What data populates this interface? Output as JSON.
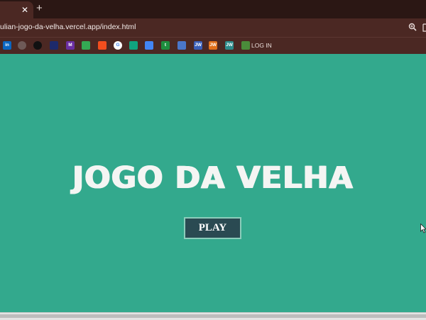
{
  "browser": {
    "tab_close": "✕",
    "new_tab": "+",
    "url": "ulian-jogo-da-velha.vercel.app/index.html",
    "bookmarks": [
      {
        "icon": "linkedin-icon",
        "color": "#0a66c2",
        "text": "in"
      },
      {
        "icon": "github-icon",
        "color": "#6e5a57",
        "text": ""
      },
      {
        "icon": "vercel-icon",
        "color": "#111111",
        "text": ""
      },
      {
        "icon": "brand-icon",
        "color": "#1d2a6b",
        "text": ""
      },
      {
        "icon": "m-icon",
        "color": "#6b2fa3",
        "text": "M"
      },
      {
        "icon": "play-store-icon",
        "color": "#34a853",
        "text": ""
      },
      {
        "icon": "figma-icon",
        "color": "#f24e1e",
        "text": ""
      },
      {
        "icon": "google-icon",
        "color": "#ffffff",
        "text": "G"
      },
      {
        "icon": "chatgpt-icon",
        "color": "#10a37f",
        "text": ""
      },
      {
        "icon": "docs-icon",
        "color": "#4285f4",
        "text": ""
      },
      {
        "icon": "sheets-t-icon",
        "color": "#1e8e3e",
        "text": "t"
      },
      {
        "icon": "square-icon",
        "color": "#4a76c9",
        "text": ""
      },
      {
        "icon": "jw-blue-icon",
        "color": "#3a5fb8",
        "text": "JW"
      },
      {
        "icon": "jw-orange-icon",
        "color": "#e0701b",
        "text": "JW"
      },
      {
        "icon": "jw-teal-icon",
        "color": "#2d8b8b",
        "text": "JW"
      },
      {
        "icon": "login-icon",
        "color": "#4a8c3a",
        "text": ""
      }
    ],
    "bookmark_label": "LOG IN"
  },
  "page": {
    "title": "JOGO DA VELHA",
    "play_label": "PLAY",
    "background": "#33a98d",
    "button_color": "#2a4a52"
  }
}
